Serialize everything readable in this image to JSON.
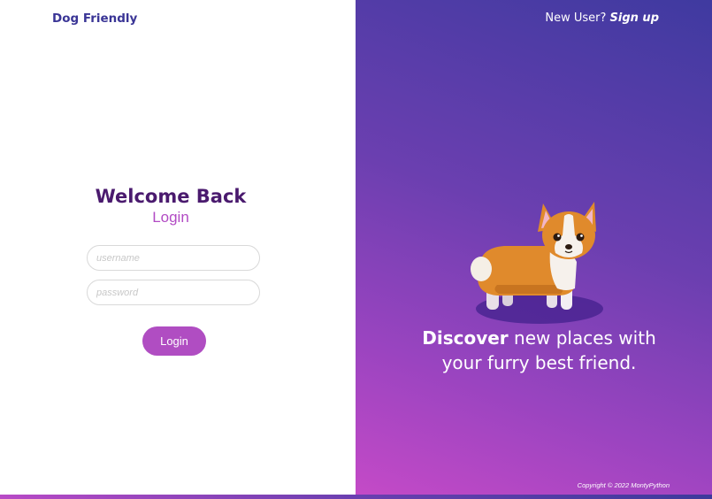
{
  "brand": "Dog Friendly",
  "login_panel": {
    "welcome": "Welcome Back",
    "subtitle": "Login",
    "username_placeholder": "username",
    "password_placeholder": "password",
    "login_button": "Login"
  },
  "header_right": {
    "new_user_text": "New User?",
    "signup_link": "Sign up"
  },
  "hero": {
    "tagline_bold": "Discover",
    "tagline_rest_line1": " new places with",
    "tagline_line2": "your furry best friend.",
    "illustration": "corgi-illustration"
  },
  "footer": {
    "copyright": "Copyright © 2022 MontyPython"
  },
  "colors": {
    "brand": "#3a3596",
    "welcome": "#4a1a6e",
    "accent": "#b04dc2",
    "gradient_top": "#3f3aa0",
    "gradient_bottom": "#c44ac7"
  }
}
